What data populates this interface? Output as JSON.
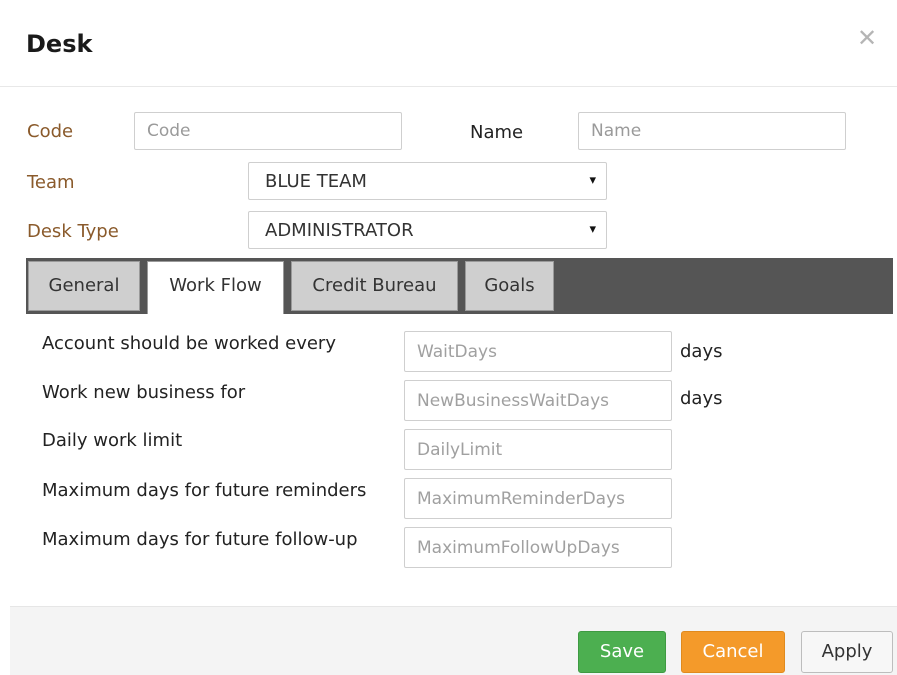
{
  "dialog": {
    "title": "Desk",
    "close_icon": "close-icon"
  },
  "form": {
    "code": {
      "label": "Code",
      "placeholder": "Code",
      "value": ""
    },
    "name": {
      "label": "Name",
      "placeholder": "Name",
      "value": ""
    },
    "team": {
      "label": "Team",
      "value": "BLUE TEAM"
    },
    "desk_type": {
      "label": "Desk Type",
      "value": "ADMINISTRATOR"
    },
    "select_arrow": "▾"
  },
  "tabs": [
    {
      "label": "General",
      "active": false
    },
    {
      "label": "Work Flow",
      "active": true
    },
    {
      "label": "Credit Bureau",
      "active": false
    },
    {
      "label": "Goals",
      "active": false
    }
  ],
  "workflow": {
    "rows": [
      {
        "label": "Account should be worked every",
        "placeholder": "WaitDays",
        "unit": "days"
      },
      {
        "label": "Work new business for",
        "placeholder": "NewBusinessWaitDays",
        "unit": "days"
      },
      {
        "label": "Daily work limit",
        "placeholder": "DailyLimit",
        "unit": ""
      },
      {
        "label": "Maximum days for future reminders",
        "placeholder": "MaximumReminderDays",
        "unit": ""
      },
      {
        "label": "Maximum days for future follow-up",
        "placeholder": "MaximumFollowUpDays",
        "unit": ""
      }
    ]
  },
  "footer": {
    "save_label": "Save",
    "cancel_label": "Cancel",
    "apply_label": "Apply"
  },
  "colors": {
    "label_brown": "#8a5a2b",
    "tabbar_bg": "#555555",
    "save_green": "#4caf50",
    "cancel_orange": "#f49a2a"
  }
}
